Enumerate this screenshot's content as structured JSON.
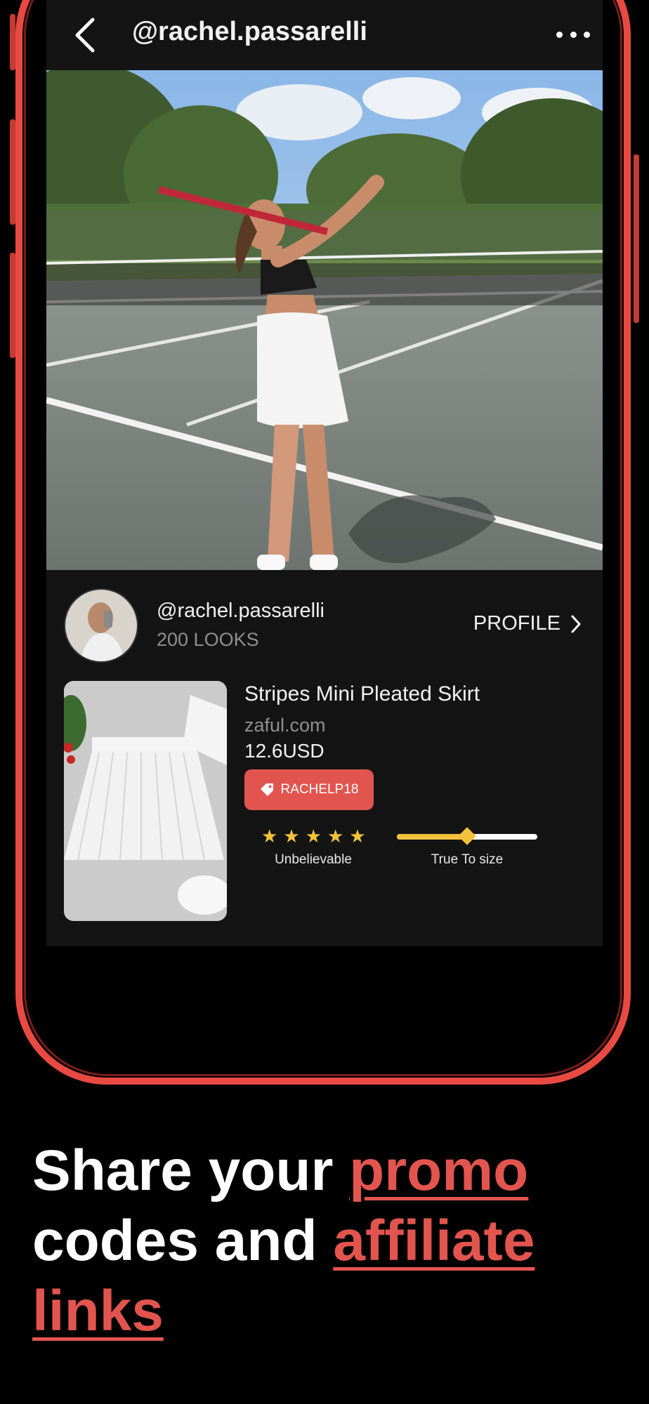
{
  "header": {
    "title": "@rachel.passarelli"
  },
  "post": {
    "username": "@rachel.passarelli",
    "looks_count": "200 LOOKS",
    "profile_label": "PROFILE"
  },
  "product": {
    "name": "Stripes Mini Pleated Skirt",
    "site": "zaful.com",
    "price": "12.6USD",
    "promo_code": "RACHELP18",
    "rating": {
      "stars": 5,
      "label": "Unbelievable"
    },
    "fit": {
      "value": 0.5,
      "label": "True To size"
    }
  },
  "headline": {
    "part1": "Share your ",
    "accent1": "promo",
    "part2": "codes and ",
    "accent2": "affiliate",
    "accent3": "links"
  },
  "colors": {
    "accent": "#e2554f",
    "frame": "#e84a42",
    "star": "#f2c23c"
  },
  "icons": [
    "back-chevron-icon",
    "more-dots-icon",
    "chevron-right-icon",
    "tag-icon",
    "star-icon"
  ]
}
